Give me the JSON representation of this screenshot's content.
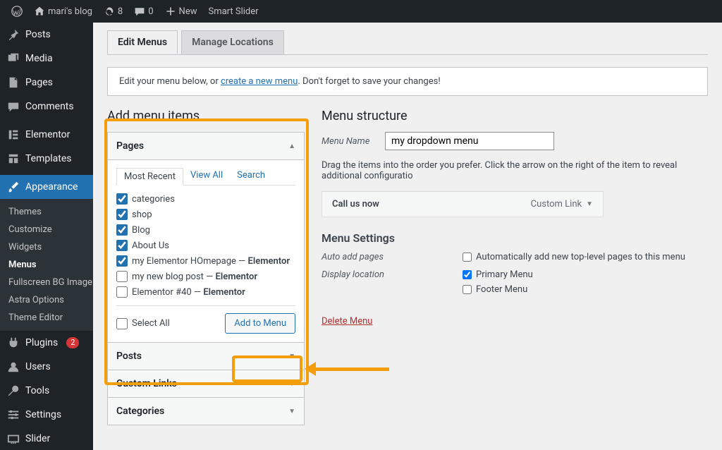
{
  "adminbar": {
    "site_name": "mari's blog",
    "updates_count": "8",
    "comments_count": "0",
    "new_label": "New",
    "smart_slider": "Smart Slider"
  },
  "sidebar": {
    "posts": "Posts",
    "media": "Media",
    "pages": "Pages",
    "comments": "Comments",
    "elementor": "Elementor",
    "templates": "Templates",
    "appearance": "Appearance",
    "submenu": {
      "themes": "Themes",
      "customize": "Customize",
      "widgets": "Widgets",
      "menus": "Menus",
      "fullscreen_bg": "Fullscreen BG Image",
      "astra_options": "Astra Options",
      "theme_editor": "Theme Editor"
    },
    "plugins": "Plugins",
    "plugins_badge": "2",
    "users": "Users",
    "tools": "Tools",
    "settings": "Settings",
    "slider": "Slider"
  },
  "tabs": {
    "edit_menus": "Edit Menus",
    "manage_locations": "Manage Locations"
  },
  "notice": {
    "prefix": "Edit your menu below, or ",
    "link": "create a new menu",
    "suffix": ". Don't forget to save your changes!"
  },
  "left": {
    "title": "Add menu items",
    "pages_acc": "Pages",
    "tabs": {
      "most_recent": "Most Recent",
      "view_all": "View All",
      "search": "Search"
    },
    "items": [
      {
        "label": "categories",
        "checked": true
      },
      {
        "label": "shop",
        "checked": true
      },
      {
        "label": "Blog",
        "checked": true
      },
      {
        "label": "About Us",
        "checked": true
      },
      {
        "label": "my Elementor HOmepage — Elementor",
        "checked": true,
        "bold_suffix": true
      },
      {
        "label": "my new blog post — Elementor",
        "checked": false,
        "bold_suffix": true
      },
      {
        "label": "Elementor #40 — Elementor",
        "checked": false,
        "bold_suffix": true
      }
    ],
    "select_all": "Select All",
    "add_to_menu": "Add to Menu",
    "posts_acc": "Posts",
    "custom_links_acc": "Custom Links",
    "categories_acc": "Categories"
  },
  "right": {
    "title": "Menu structure",
    "menu_name_label": "Menu Name",
    "menu_name_value": "my dropdown menu",
    "instructions": "Drag the items into the order you prefer. Click the arrow on the right of the item to reveal additional configuratio",
    "item_label": "Call us now",
    "item_type": "Custom Link",
    "settings_title": "Menu Settings",
    "auto_add_label": "Auto add pages",
    "auto_add_option": "Automatically add new top-level pages to this menu",
    "display_loc_label": "Display location",
    "primary_menu": "Primary Menu",
    "footer_menu": "Footer Menu",
    "delete_menu": "Delete Menu"
  }
}
